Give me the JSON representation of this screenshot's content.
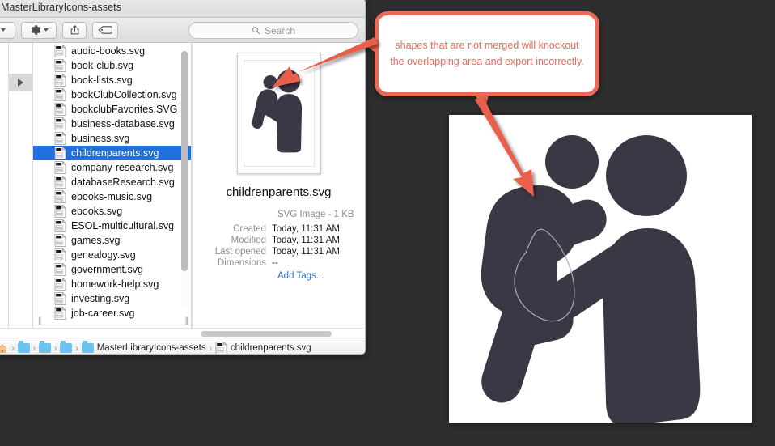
{
  "window": {
    "title": "MasterLibraryIcons-assets"
  },
  "toolbar": {
    "nav_chevron_label": "⌄",
    "action_icon": "gear-icon",
    "share_icon": "share-icon",
    "tag_icon": "tag-icon"
  },
  "search": {
    "placeholder": "Search",
    "icon": "search-icon"
  },
  "files": [
    {
      "name": "audio-books.svg",
      "selected": false
    },
    {
      "name": "book-club.svg",
      "selected": false
    },
    {
      "name": "book-lists.svg",
      "selected": false
    },
    {
      "name": "bookClubCollection.svg",
      "selected": false
    },
    {
      "name": "bookclubFavorites.SVG",
      "selected": false
    },
    {
      "name": "business-database.svg",
      "selected": false
    },
    {
      "name": "business.svg",
      "selected": false
    },
    {
      "name": "childrenparents.svg",
      "selected": true
    },
    {
      "name": "company-research.svg",
      "selected": false
    },
    {
      "name": "databaseResearch.svg",
      "selected": false
    },
    {
      "name": "ebooks-music.svg",
      "selected": false
    },
    {
      "name": "ebooks.svg",
      "selected": false
    },
    {
      "name": "ESOL-multicultural.svg",
      "selected": false
    },
    {
      "name": "games.svg",
      "selected": false
    },
    {
      "name": "genealogy.svg",
      "selected": false
    },
    {
      "name": "government.svg",
      "selected": false
    },
    {
      "name": "homework-help.svg",
      "selected": false
    },
    {
      "name": "investing.svg",
      "selected": false
    },
    {
      "name": "job-career.svg",
      "selected": false
    }
  ],
  "preview": {
    "filename": "childrenparents.svg",
    "kind": "SVG Image - 1 KB",
    "rows": [
      {
        "key": "Created",
        "value": "Today, 11:31 AM"
      },
      {
        "key": "Modified",
        "value": "Today, 11:31 AM"
      },
      {
        "key": "Last opened",
        "value": "Today, 11:31 AM"
      },
      {
        "key": "Dimensions",
        "value": "--"
      }
    ],
    "add_tags": "Add Tags..."
  },
  "pathbar": {
    "home_icon": "home-icon",
    "folder_label": "MasterLibraryIcons-assets",
    "file_label": "childrenparents.svg"
  },
  "callout": {
    "text": "shapes that are not merged will knockout the overlapping area and export incorrectly."
  },
  "colors": {
    "accent_red": "#ea6a59",
    "arrow_red": "#e8604c",
    "figure_dark": "#3b3745",
    "selection_blue": "#1f70de",
    "link_blue": "#2a6fd4",
    "desktop_bg": "#2e2e2e"
  }
}
